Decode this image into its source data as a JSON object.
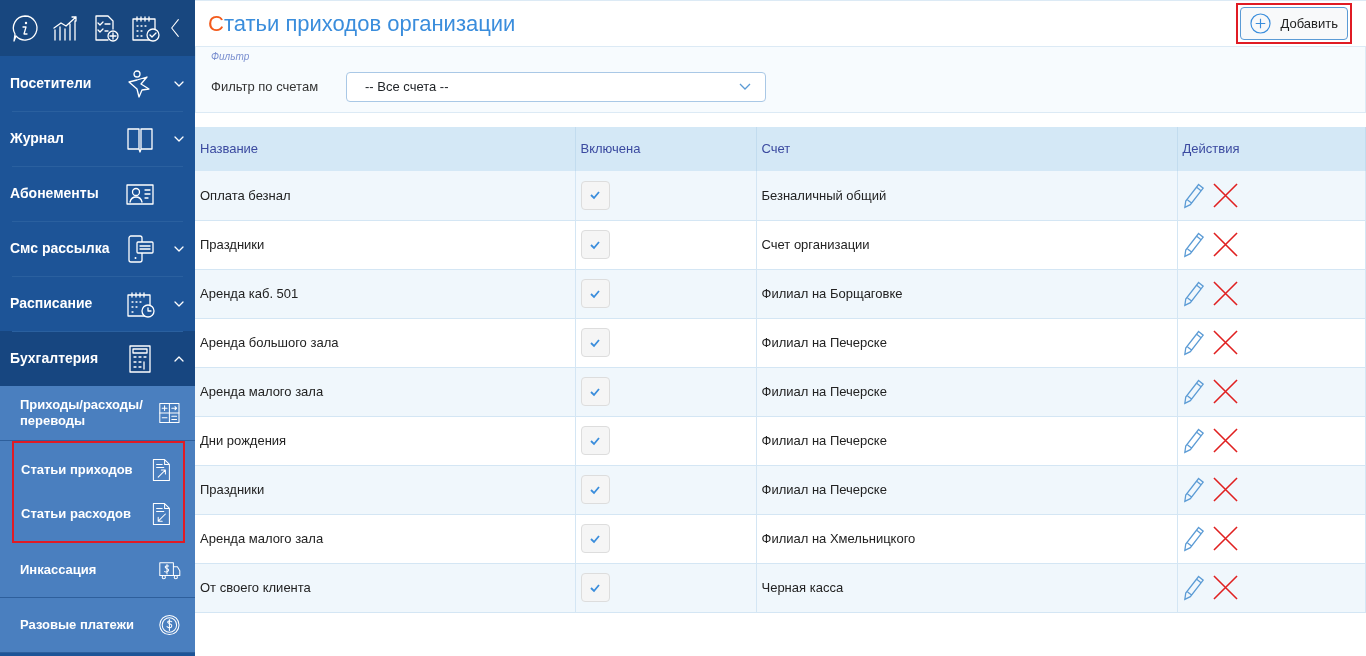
{
  "sidebar": {
    "items": [
      {
        "label": "Посетители",
        "has_caret": true,
        "expanded": false
      },
      {
        "label": "Журнал",
        "has_caret": true,
        "expanded": false
      },
      {
        "label": "Абонементы",
        "has_caret": false,
        "expanded": false
      },
      {
        "label": "Смс рассылка",
        "has_caret": true,
        "expanded": false
      },
      {
        "label": "Расписание",
        "has_caret": true,
        "expanded": false
      },
      {
        "label": "Бухгалтерия",
        "has_caret": true,
        "expanded": true,
        "children": [
          {
            "label": "Приходы/расходы/ переводы",
            "highlighted": false
          },
          {
            "label": "Статьи приходов",
            "highlighted": true
          },
          {
            "label": "Статьи расходов",
            "highlighted": true
          },
          {
            "label": "Инкассация",
            "highlighted": false
          },
          {
            "label": "Разовые платежи",
            "highlighted": false
          }
        ]
      }
    ]
  },
  "page": {
    "title": "Статьи приходов организации",
    "add_button": {
      "label": "Добавить",
      "highlighted": true
    }
  },
  "filter": {
    "legend": "Фильтр",
    "label": "Фильтр по счетам",
    "value": "-- Все счета --"
  },
  "table": {
    "columns": [
      "Название",
      "Включена",
      "Счет",
      "Действия"
    ],
    "rows": [
      {
        "name": "Оплата безнал",
        "enabled": true,
        "account": "Безналичный общий"
      },
      {
        "name": "Праздники",
        "enabled": true,
        "account": "Счет организации"
      },
      {
        "name": "Аренда каб. 501",
        "enabled": true,
        "account": "Филиал на Борщаговке"
      },
      {
        "name": "Аренда большого зала",
        "enabled": true,
        "account": "Филиал на Печерске"
      },
      {
        "name": "Аренда малого зала",
        "enabled": true,
        "account": "Филиал на Печерске"
      },
      {
        "name": "Дни рождения",
        "enabled": true,
        "account": "Филиал на Печерске"
      },
      {
        "name": "Праздники",
        "enabled": true,
        "account": "Филиал на Печерске"
      },
      {
        "name": "Аренда малого зала",
        "enabled": true,
        "account": "Филиал на Хмельницкого"
      },
      {
        "name": "От своего клиента",
        "enabled": true,
        "account": "Черная касса"
      }
    ]
  }
}
